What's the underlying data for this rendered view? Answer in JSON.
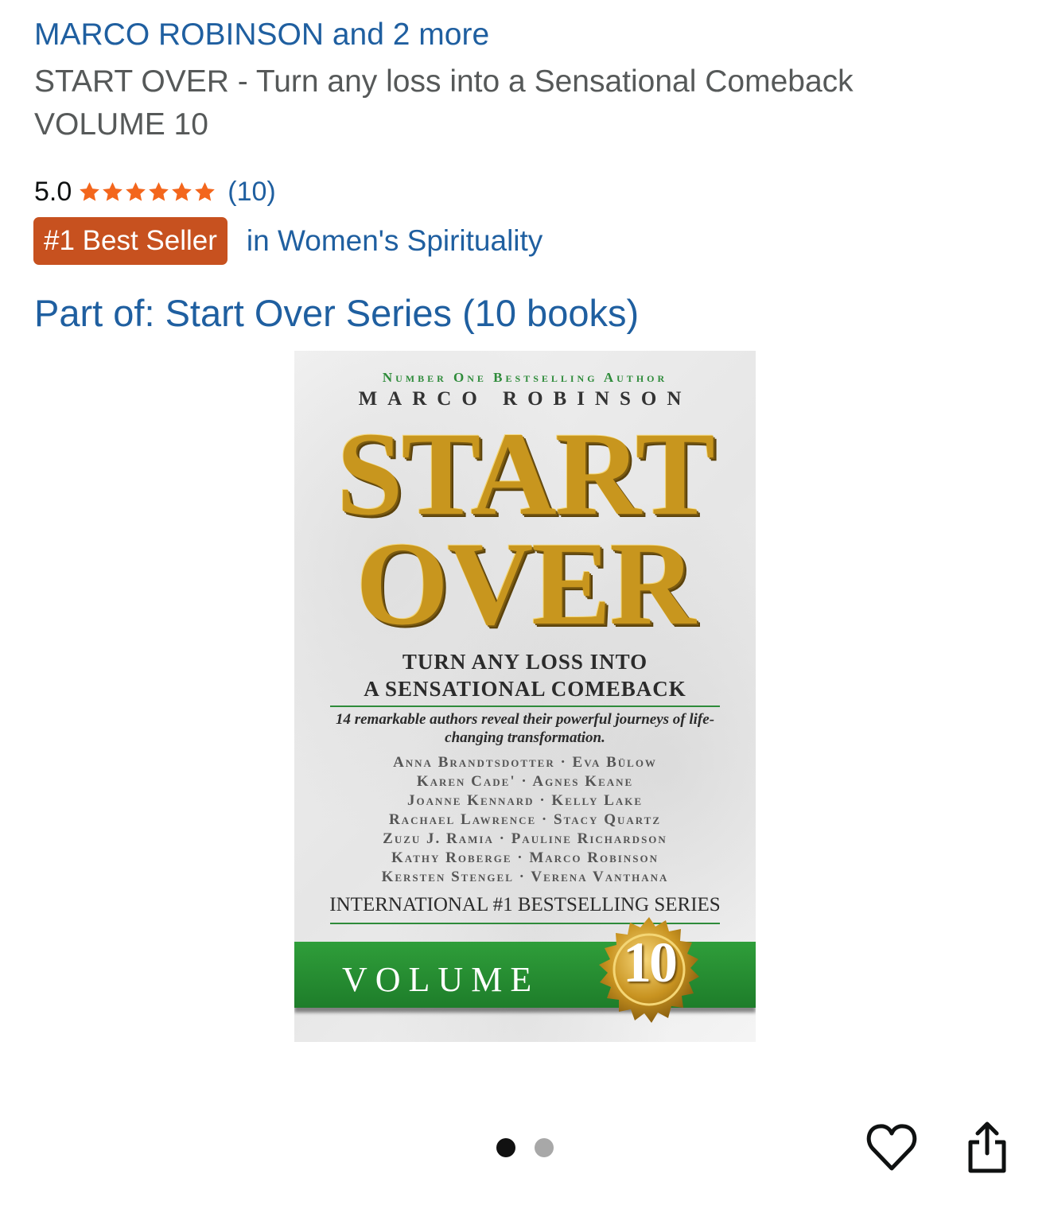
{
  "product": {
    "authors": "MARCO ROBINSON and 2 more",
    "title": "START OVER - Turn any loss into a Sensational Comeback VOLUME 10",
    "rating_value": "5.0",
    "rating_stars": 5,
    "rating_count": "(10)",
    "badge": "#1 Best Seller",
    "badge_category": "in Women's Spirituality",
    "series": "Part of: Start Over Series (10 books)"
  },
  "cover": {
    "tagline": "Number One Bestselling Author",
    "author": "MARCO ROBINSON",
    "title_line1": "START",
    "title_line2": "OVER",
    "subtitle_line1": "TURN ANY LOSS INTO",
    "subtitle_line2": "A SENSATIONAL COMEBACK",
    "description": "14 remarkable authors reveal their powerful journeys of life-changing transformation.",
    "contributors": [
      "Anna Brandtsdotter · Eva Bülow",
      "Karen Cade' · Agnes Keane",
      "Joanne Kennard · Kelly Lake",
      "Rachael Lawrence · Stacy Quartz",
      "Zuzu J. Ramia · Pauline Richardson",
      "Kathy Roberge · Marco Robinson",
      "Kersten Stengel · Verena Vanthana"
    ],
    "series_line": "INTERNATIONAL #1 BESTSELLING SERIES",
    "volume_label": "VOLUME",
    "volume_number": "10"
  },
  "carousel": {
    "total": 2,
    "active_index": 0
  },
  "actions": {
    "favorite_icon": "heart-outline-icon",
    "share_icon": "share-icon"
  },
  "colors": {
    "link": "#1f5fa0",
    "badge_bg": "#c7511f",
    "star": "#f3661c",
    "cover_green": "#2f9e3a",
    "cover_gold": "#c8961e"
  }
}
